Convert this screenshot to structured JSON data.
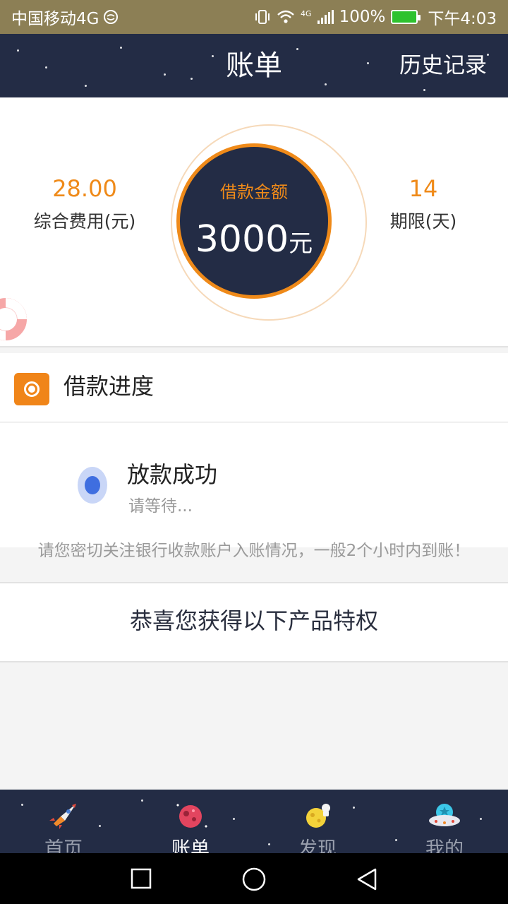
{
  "status_bar": {
    "carrier": "中国移动4G",
    "network": "4G",
    "battery": "100%",
    "time": "下午4:03"
  },
  "header": {
    "title": "账单",
    "history_link": "历史记录"
  },
  "summary": {
    "fee_value": "28.00",
    "fee_label": "综合费用(元)",
    "loan_label": "借款金额",
    "loan_amount": "3000",
    "loan_unit": "元",
    "term_value": "14",
    "term_label": "期限(天)"
  },
  "progress": {
    "section_title": "借款进度",
    "step_title": "放款成功",
    "step_status": "请等待..."
  },
  "notice": "请您密切关注银行收款账户入账情况，一般2个小时内到账！",
  "privilege": "恭喜您获得以下产品特权",
  "tabs": [
    {
      "label": "首页",
      "icon": "rocket-icon"
    },
    {
      "label": "账单",
      "icon": "planet-icon"
    },
    {
      "label": "发现",
      "icon": "astronaut-planet-icon"
    },
    {
      "label": "我的",
      "icon": "ufo-icon"
    }
  ],
  "active_tab": "账单",
  "colors": {
    "accent": "#ef8a19",
    "navy": "#232c45",
    "status_bar": "#8c7f55",
    "progress_dot": "#3f6ee0"
  }
}
